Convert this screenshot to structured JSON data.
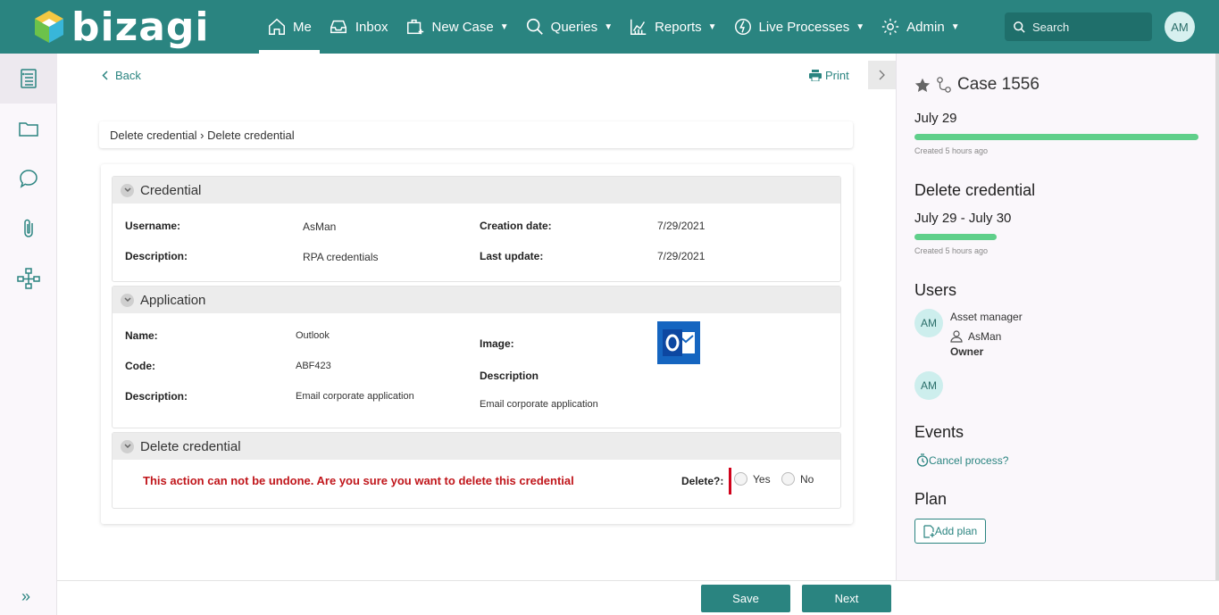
{
  "header": {
    "logo_text": "bizagi",
    "nav": [
      {
        "label": "Me",
        "icon": "home-icon"
      },
      {
        "label": "Inbox",
        "icon": "inbox-icon"
      },
      {
        "label": "New Case",
        "icon": "new-case-icon"
      },
      {
        "label": "Queries",
        "icon": "search-icon"
      },
      {
        "label": "Reports",
        "icon": "chart-icon"
      },
      {
        "label": "Live Processes",
        "icon": "live-process-icon"
      },
      {
        "label": "Admin",
        "icon": "gear-icon"
      }
    ],
    "search_placeholder": "Search",
    "user_initials": "AM"
  },
  "colors": {
    "brand": "#2a8480",
    "danger": "#c0161b",
    "progress": "#5fcf8a"
  },
  "toolbar": {
    "back": "Back",
    "print": "Print"
  },
  "breadcrumb": "Delete credential › Delete credential",
  "credential": {
    "title": "Credential",
    "username_label": "Username:",
    "username": "AsMan",
    "description_label": "Description:",
    "description": "RPA credentials",
    "creation_label": "Creation date:",
    "creation": "7/29/2021",
    "update_label": "Last update:",
    "update": "7/29/2021"
  },
  "application": {
    "title": "Application",
    "name_label": "Name:",
    "name": "Outlook",
    "code_label": "Code:",
    "code": "ABF423",
    "description_label": "Description:",
    "description": "Email corporate application",
    "image_label": "Image:",
    "desc2_label": "Description",
    "desc2": "Email corporate application"
  },
  "delete_section": {
    "title": "Delete credential",
    "warning": "This action can not be undone. Are you sure you want to delete this credential",
    "question": "Delete?:",
    "yes": "Yes",
    "no": "No"
  },
  "buttons": {
    "save": "Save",
    "next": "Next"
  },
  "panel": {
    "case": "Case 1556",
    "case_date": "July 29",
    "case_created": "Created 5 hours ago",
    "task": "Delete credential",
    "task_date": "July 29 - July 30",
    "task_created": "Created 5 hours ago",
    "users_title": "Users",
    "user1_initials": "AM",
    "user1_role": "Asset manager",
    "user1_name": "AsMan",
    "user1_type": "Owner",
    "user2_initials": "AM",
    "events_title": "Events",
    "event": "Cancel process?",
    "plan_title": "Plan",
    "add_plan": "Add plan"
  }
}
